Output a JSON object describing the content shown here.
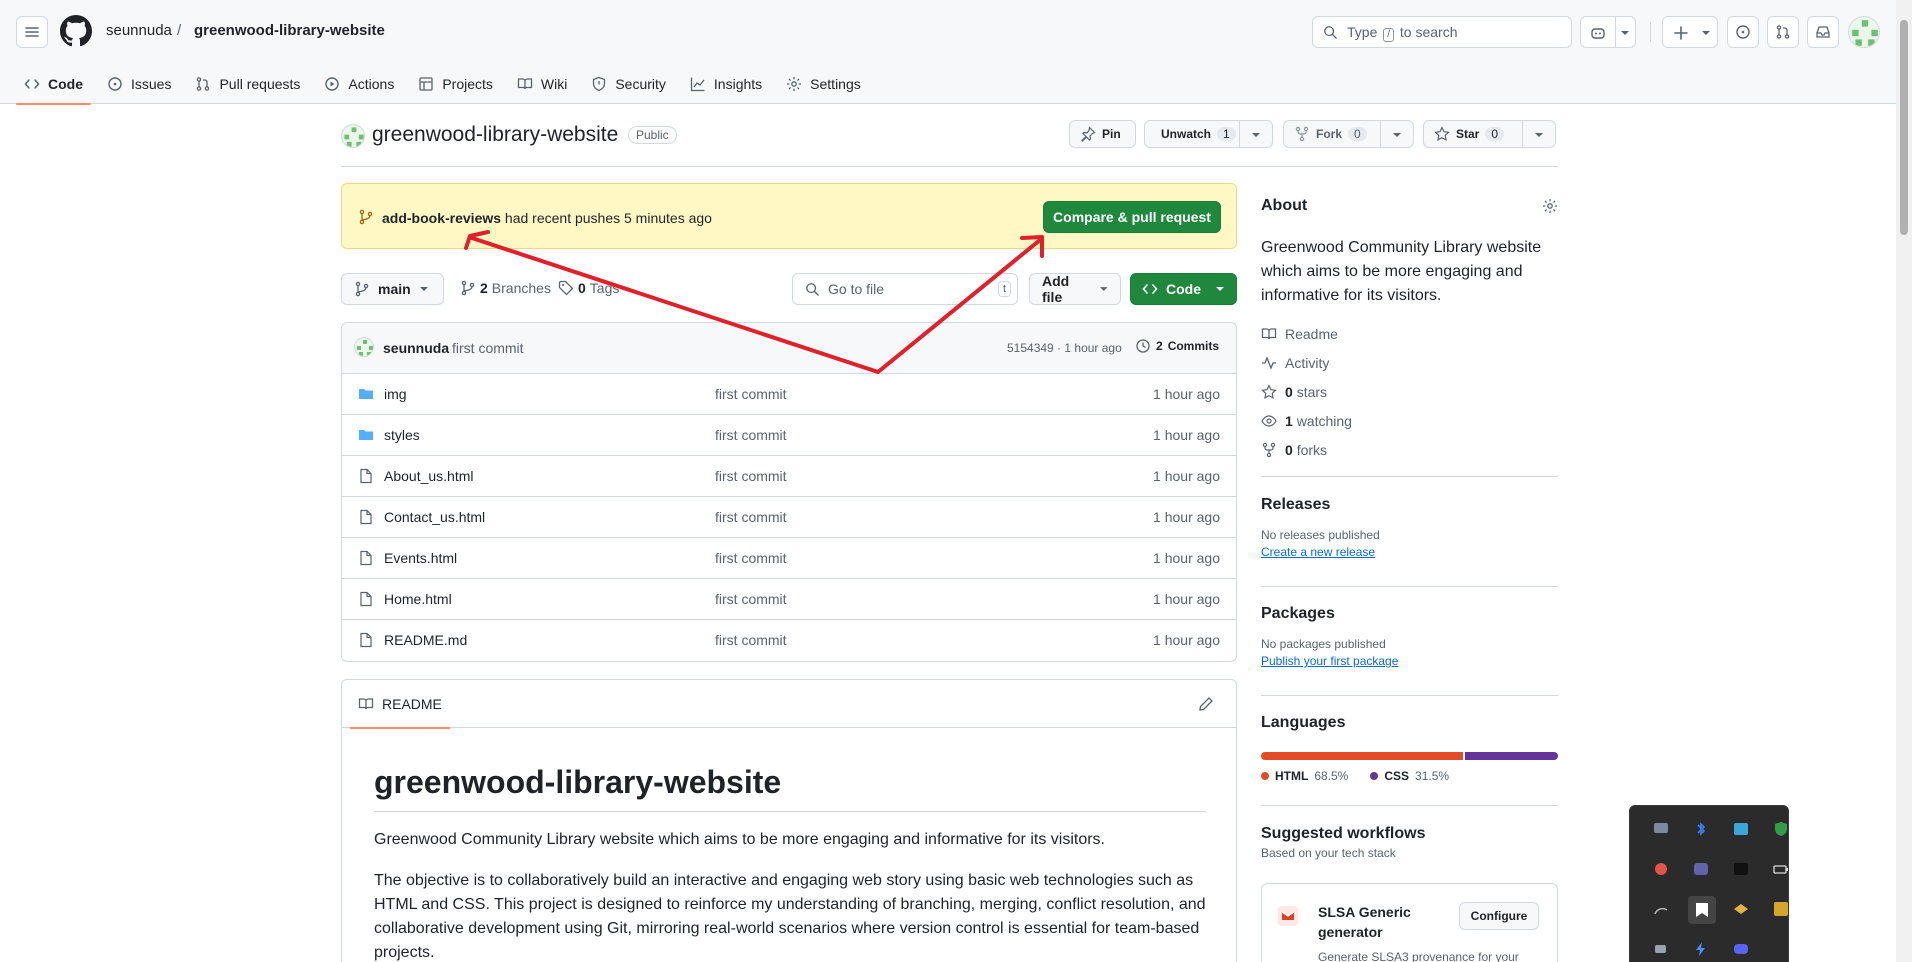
{
  "header": {
    "owner": "seunnuda",
    "separator": "/",
    "repo": "greenwood-library-website",
    "search_prefix": "Type",
    "search_key": "/",
    "search_suffix": "to search"
  },
  "tabs": [
    {
      "label": "Code"
    },
    {
      "label": "Issues"
    },
    {
      "label": "Pull requests"
    },
    {
      "label": "Actions"
    },
    {
      "label": "Projects"
    },
    {
      "label": "Wiki"
    },
    {
      "label": "Security"
    },
    {
      "label": "Insights"
    },
    {
      "label": "Settings"
    }
  ],
  "repo": {
    "name": "greenwood-library-website",
    "visibility": "Public",
    "pin_label": "Pin",
    "unwatch_label": "Unwatch",
    "watch_count": "1",
    "fork_label": "Fork",
    "fork_count": "0",
    "star_label": "Star",
    "star_count": "0"
  },
  "banner": {
    "branch": "add-book-reviews",
    "text": "had recent pushes 5 minutes ago",
    "button": "Compare & pull request"
  },
  "toolbar": {
    "branch": "main",
    "branches_count": "2",
    "branches_label": "Branches",
    "tags_count": "0",
    "tags_label": "Tags",
    "goto_placeholder": "Go to file",
    "goto_key": "t",
    "add_file": "Add file",
    "code": "Code"
  },
  "last_commit": {
    "author": "seunnuda",
    "message": "first commit",
    "hash_time": "5154349 · 1 hour ago",
    "commits_count": "2",
    "commits_label": "Commits"
  },
  "files": [
    {
      "name": "img",
      "type": "folder",
      "message": "first commit",
      "time": "1 hour ago"
    },
    {
      "name": "styles",
      "type": "folder",
      "message": "first commit",
      "time": "1 hour ago"
    },
    {
      "name": "About_us.html",
      "type": "file",
      "message": "first commit",
      "time": "1 hour ago"
    },
    {
      "name": "Contact_us.html",
      "type": "file",
      "message": "first commit",
      "time": "1 hour ago"
    },
    {
      "name": "Events.html",
      "type": "file",
      "message": "first commit",
      "time": "1 hour ago"
    },
    {
      "name": "Home.html",
      "type": "file",
      "message": "first commit",
      "time": "1 hour ago"
    },
    {
      "name": "README.md",
      "type": "file",
      "message": "first commit",
      "time": "1 hour ago"
    }
  ],
  "readme": {
    "tab": "README",
    "title": "greenwood-library-website",
    "p1": "Greenwood Community Library website which aims to be more engaging and informative for its visitors.",
    "p2": "The objective is to collaboratively build an interactive and engaging web story using basic web technologies such as HTML and CSS. This project is designed to reinforce my understanding of branching, merging, conflict resolution, and collaborative development using Git, mirroring real-world scenarios where version control is essential for team-based projects."
  },
  "about": {
    "title": "About",
    "description": "Greenwood Community Library website which aims to be more engaging and informative for its visitors.",
    "readme": "Readme",
    "activity": "Activity",
    "stars_count": "0",
    "stars_label": "stars",
    "watching_count": "1",
    "watching_label": "watching",
    "forks_count": "0",
    "forks_label": "forks"
  },
  "releases": {
    "title": "Releases",
    "none": "No releases published",
    "link": "Create a new release"
  },
  "packages": {
    "title": "Packages",
    "none": "No packages published",
    "link": "Publish your first package"
  },
  "languages": {
    "title": "Languages",
    "items": [
      {
        "name": "HTML",
        "percent": "68.5%",
        "value": 68.5,
        "color": "#e34c26"
      },
      {
        "name": "CSS",
        "percent": "31.5%",
        "value": 31.5,
        "color": "#663399"
      }
    ]
  },
  "workflows": {
    "title": "Suggested workflows",
    "subtitle": "Based on your tech stack",
    "item_name": "SLSA Generic generator",
    "item_desc": "Generate SLSA3 provenance for your",
    "configure": "Configure"
  },
  "colors": {
    "accent_green": "#1f883d",
    "tab_underline": "#fd8c73",
    "annotation_red": "#e0202a",
    "folder_blue": "#54aeff"
  }
}
